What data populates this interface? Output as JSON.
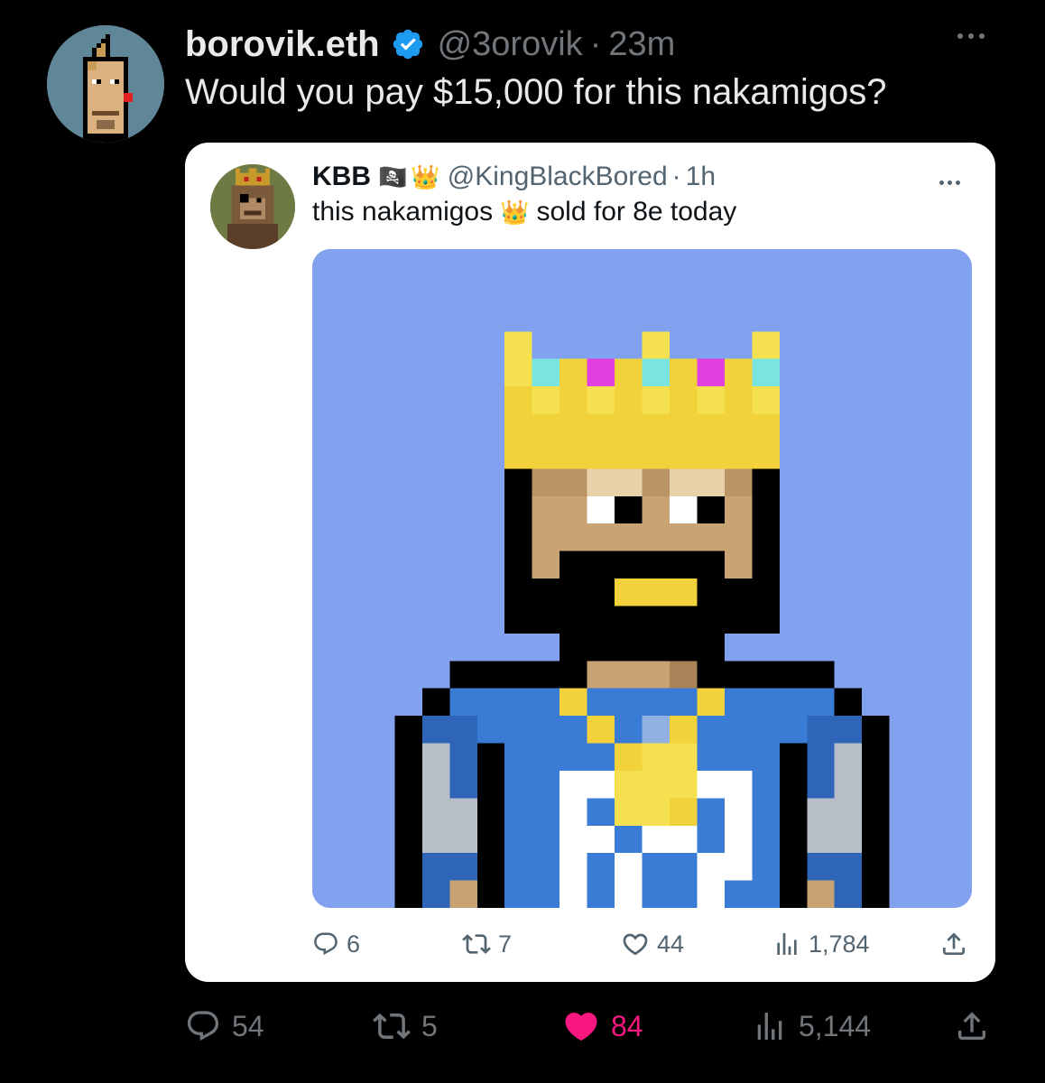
{
  "author": {
    "display_name": "borovik.eth",
    "handle": "@3orovik",
    "separator": "·",
    "time": "23m",
    "verified_icon": "verified-badge-icon"
  },
  "tweet": {
    "text": "Would you pay $15,000 for this nakamigos?"
  },
  "quoted": {
    "display_name": "KBB",
    "flag_emoji": "🏴‍☠️",
    "crown_emoji": "👑",
    "handle": "@KingBlackBored",
    "separator": "·",
    "time": "1h",
    "text_before": "this nakamigos",
    "text_after": "sold for 8e today",
    "media_background": "#82a2ef",
    "stats": {
      "replies": "6",
      "reposts": "7",
      "likes": "44",
      "views": "1,784"
    }
  },
  "stats": {
    "replies": "54",
    "reposts": "5",
    "likes": "84",
    "views": "5,144",
    "liked": true,
    "like_color": "#f91880"
  },
  "colors": {
    "background": "#000000",
    "text_primary": "#e7e9ea",
    "text_secondary": "#71767b",
    "verified_blue": "#1d9bf0"
  }
}
